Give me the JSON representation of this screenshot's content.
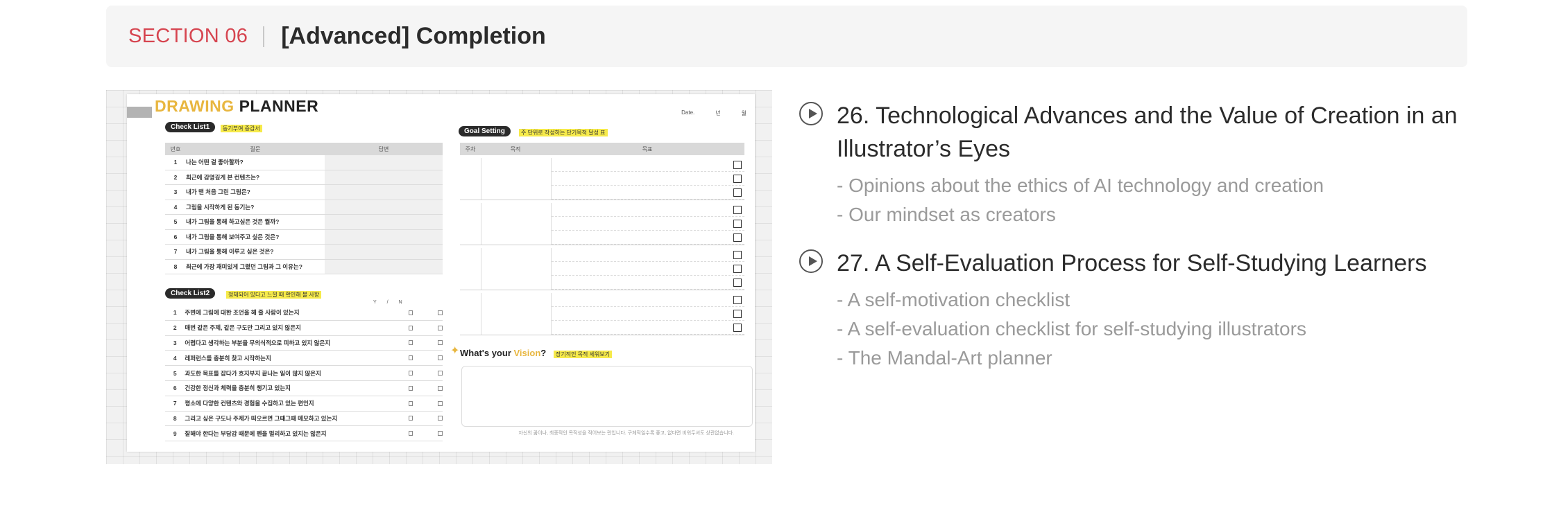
{
  "section": {
    "label": "SECTION 06",
    "title": "[Advanced] Completion"
  },
  "planner": {
    "title_word1": "DRAWING",
    "title_word2": "PLANNER",
    "date_labels": [
      "Date.",
      "년",
      "월"
    ],
    "check_list_1": {
      "label": "Check List1",
      "note": "동기부여 증감서",
      "headers": [
        "번호",
        "질문",
        "답변"
      ],
      "rows": [
        {
          "n": "1",
          "q": "나는 어떤 걸 좋아할까?"
        },
        {
          "n": "2",
          "q": "최근에 감명깊게 본 컨텐츠는?"
        },
        {
          "n": "3",
          "q": "내가 맨 처음 그린 그림은?"
        },
        {
          "n": "4",
          "q": "그림을 시작하게 된 동기는?"
        },
        {
          "n": "5",
          "q": "내가 그림을 통해 하고싶은 것은 뭘까?"
        },
        {
          "n": "6",
          "q": "내가 그림을 통해 보여주고 싶은 것은?"
        },
        {
          "n": "7",
          "q": "내가 그림을 통해 이루고 싶은 것은?"
        },
        {
          "n": "8",
          "q": "최근에 가장 재미있게 그렸던 그림과 그 이유는?"
        }
      ]
    },
    "check_list_2": {
      "label": "Check List2",
      "note": "정체되어 있다고 느낄 때 확인해 볼 사항",
      "yn_labels": [
        "Y",
        "/",
        "N"
      ],
      "rows": [
        {
          "n": "1",
          "q": "주변에 그림에 대한 조언을 해 줄 사람이 있는지"
        },
        {
          "n": "2",
          "q": "매번 같은 주제, 같은 구도만 그리고 있지 않은지"
        },
        {
          "n": "3",
          "q": "어렵다고 생각하는 부분을 무의식적으로 피하고 있지 않은지"
        },
        {
          "n": "4",
          "q": "레퍼런스를 충분히 찾고 시작하는지"
        },
        {
          "n": "5",
          "q": "과도한 목표를 잡다가 흐지부지 끝나는 일이 많지 않은지"
        },
        {
          "n": "6",
          "q": "건강한 정신과 체력을 충분히 챙기고 있는지"
        },
        {
          "n": "7",
          "q": "평소에 다양한 컨텐츠와 경험을 수집하고 있는 편인지"
        },
        {
          "n": "8",
          "q": "그리고 싶은 구도나 주제가 떠오르면 그때그때 메모하고 있는지"
        },
        {
          "n": "9",
          "q": "잘해야 한다는 부담감 때문에 펜을 멀리하고 있지는 않은지"
        }
      ]
    },
    "goal_setting": {
      "label": "Goal Setting",
      "note": "주 단위로 작성하는 단기목적 달성 표",
      "headers": [
        "주차",
        "목적",
        "목표"
      ]
    },
    "vision": {
      "prefix": "What's your ",
      "word": "Vision",
      "suffix": "?",
      "note": "장기적인 목적 세워보기",
      "footnote": "자신의 꿈이나, 최종적인 목적성을 적어보는 란입니다. 구체적일수록 좋고, 없다면 비워두셔도 상관없습니다."
    }
  },
  "chapters": [
    {
      "title": "26. Technological Advances and the Value of Creation in an Illustrator’s Eyes",
      "items": [
        "- Opinions about the ethics of AI technology and creation",
        "- Our mindset as creators"
      ]
    },
    {
      "title": "27. A Self-Evaluation Process for Self-Studying Learners",
      "items": [
        "- A self-motivation checklist",
        "- A self-evaluation checklist for self-studying illustrators",
        "- The Mandal-Art planner"
      ]
    }
  ]
}
